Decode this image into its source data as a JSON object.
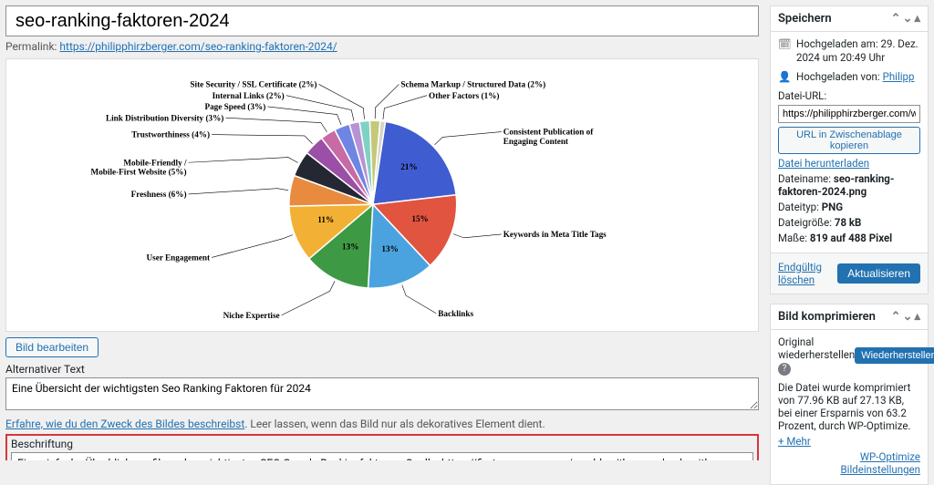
{
  "title": "seo-ranking-faktoren-2024",
  "permalink": {
    "label": "Permalink:",
    "url": "https://philipphirzberger.com/seo-ranking-faktoren-2024/"
  },
  "edit_image_btn": "Bild bearbeiten",
  "alt_text": {
    "label": "Alternativer Text",
    "value": "Eine Übersicht der wichtigsten Seo Ranking Faktoren für 2024",
    "help_link": "Erfahre, wie du den Zweck des Bildes beschreibst",
    "help_rest": ". Leer lassen, wenn das Bild nur als dekoratives Element dient."
  },
  "caption": {
    "label": "Beschriftung",
    "value": "Eine einfache Überblicksgrafik zu den wichtigsten SEO Google Rankingfaktoren. Quelle: https://firstpagesage.com/seo-blog/the-google-algorithm-ranking-factors/"
  },
  "save_panel": {
    "title": "Speichern",
    "uploaded_on": "Hochgeladen am: 29. Dez. 2024 um 20:49 Uhr",
    "uploaded_by_label": "Hochgeladen von:",
    "uploaded_by": "Philipp",
    "file_url_label": "Datei-URL:",
    "file_url": "https://philipphirzberger.com/wp-cont",
    "copy_btn": "URL in Zwischenablage kopieren",
    "download": "Datei herunterladen",
    "filename_label": "Dateiname:",
    "filename": "seo-ranking-faktoren-2024.png",
    "filetype_label": "Dateityp:",
    "filetype": "PNG",
    "filesize_label": "Dateigröße:",
    "filesize": "78 kB",
    "dimensions_label": "Maße:",
    "dimensions": "819 auf 488 Pixel",
    "delete": "Endgültig löschen",
    "update": "Aktualisieren"
  },
  "compress_panel": {
    "title": "Bild komprimieren",
    "restore_label": "Original wiederherstellen",
    "restore_btn": "Wiederherstellen",
    "msg": "Die Datei wurde komprimiert von 77.96 KB auf 27.13 KB, bei einer Ersparnis von 63.2 Prozent, durch WP-Optimize.",
    "more": "+ Mehr",
    "settings": "WP-Optimize Bildeinstellungen"
  },
  "chart_data": {
    "type": "pie",
    "title": "",
    "series": [
      {
        "name": "Consistent Publication of Engaging Content",
        "value": 21,
        "color": "#3f5dd0",
        "label_shown": "21%"
      },
      {
        "name": "Keywords in Meta Title Tags",
        "value": 15,
        "color": "#e1543f",
        "label_shown": "15%"
      },
      {
        "name": "Backlinks",
        "value": 13,
        "color": "#4aa3df",
        "label_shown": "13%"
      },
      {
        "name": "Niche Expertise",
        "value": 13,
        "color": "#3d9944",
        "label_shown": "13%"
      },
      {
        "name": "User Engagement",
        "value": 11,
        "color": "#f2b134",
        "label_shown": "11%"
      },
      {
        "name": "Freshness (6%)",
        "value": 6,
        "color": "#e88b3f",
        "label_shown": ""
      },
      {
        "name": "Mobile-Friendly / Mobile-First Website (5%)",
        "value": 5,
        "color": "#252832",
        "label_shown": ""
      },
      {
        "name": "Trustworthiness (4%)",
        "value": 4,
        "color": "#9b4fa6",
        "label_shown": ""
      },
      {
        "name": "Link Distribution Diversity (3%)",
        "value": 3,
        "color": "#c76aa5",
        "label_shown": ""
      },
      {
        "name": "Page Speed (3%)",
        "value": 3,
        "color": "#6f85e3",
        "label_shown": ""
      },
      {
        "name": "Internal Links (2%)",
        "value": 2,
        "color": "#b793d6",
        "label_shown": ""
      },
      {
        "name": "Site Security / SSL Certificate (2%)",
        "value": 2,
        "color": "#7fd1c4",
        "label_shown": ""
      },
      {
        "name": "Schema Markup / Structured Data (2%)",
        "value": 2,
        "color": "#c4c97a",
        "label_shown": ""
      },
      {
        "name": "Other Factors (1%)",
        "value": 1,
        "color": "#d7d3c6",
        "label_shown": ""
      }
    ]
  }
}
